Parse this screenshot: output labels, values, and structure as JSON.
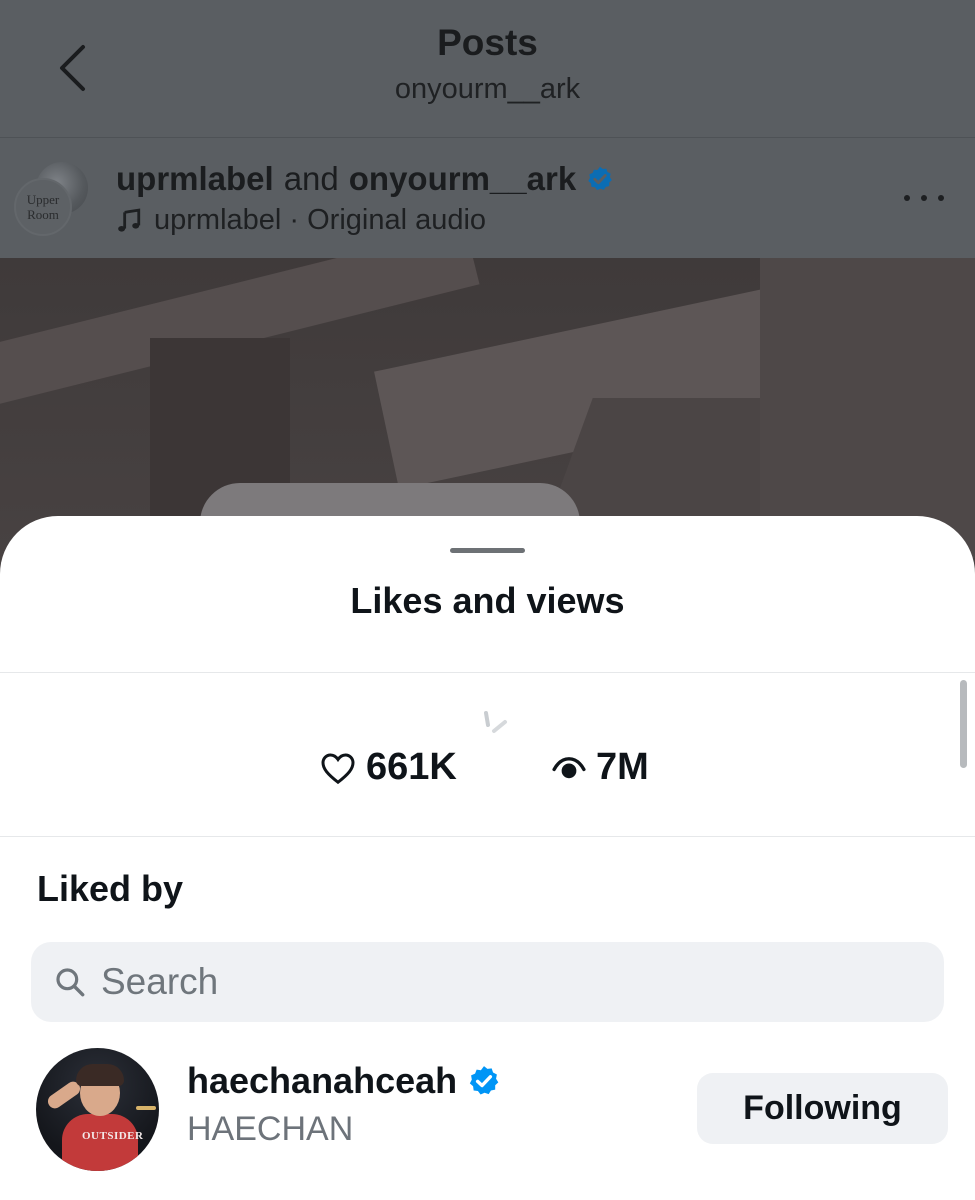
{
  "topbar": {
    "title": "Posts",
    "subtitle": "onyourm__ark",
    "back_icon": "chevron-left-icon"
  },
  "post": {
    "avatar_text_line1": "Upper",
    "avatar_text_line2": "Room",
    "author_primary": "uprmlabel",
    "author_joiner": "and",
    "author_secondary": "onyourm__ark",
    "verified": true,
    "audio_icon": "music-note-icon",
    "audio_text": "uprmlabel · Original audio",
    "more_icon": "more-horizontal-icon"
  },
  "sheet": {
    "title": "Likes and views",
    "stats": {
      "likes": "661K",
      "likes_icon": "heart-outline-icon",
      "views": "7M",
      "views_icon": "eye-icon"
    },
    "liked_by_heading": "Liked by",
    "search": {
      "placeholder": "Search",
      "value": ""
    },
    "users": [
      {
        "handle": "haechanahceah",
        "display_name": "HAECHAN",
        "verified": true,
        "avatar_shirt_text": "OUTSIDER",
        "button_label": "Following"
      }
    ]
  },
  "colors": {
    "verified_blue": "#0095f6",
    "overlay_gray": "#5b5f63",
    "button_bg": "#eff1f4"
  }
}
